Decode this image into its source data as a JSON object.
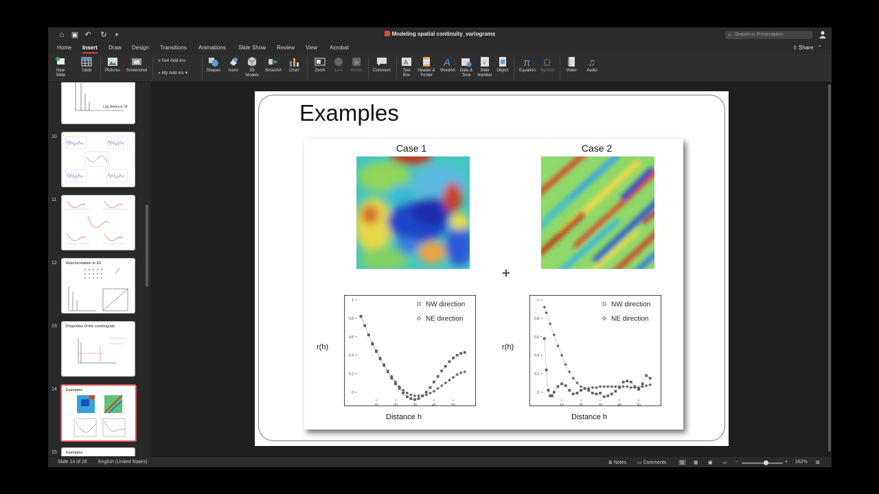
{
  "window": {
    "title": "Modeling spatial continuity_variograms",
    "search_placeholder": "Search in Presentation",
    "share_label": "Share"
  },
  "tabs": [
    "Home",
    "Insert",
    "Draw",
    "Design",
    "Transitions",
    "Animations",
    "Slide Show",
    "Review",
    "View",
    "Acrobat"
  ],
  "active_tab": "Insert",
  "ribbon": {
    "new_slide": "New Slide",
    "table": "Table",
    "pictures": "Pictures",
    "screenshot": "Screenshot",
    "get_addins": "Get Add-ins",
    "my_addins": "My Add-ins",
    "shapes": "Shapes",
    "icons": "Icons",
    "models_3d": "3D Models",
    "smartart": "SmartArt",
    "chart": "Chart",
    "zoom": "Zoom",
    "link": "Link",
    "action": "Action",
    "comment": "Comment",
    "text_box": "Text Box",
    "header_footer": "Header & Footer",
    "wordart": "WordArt",
    "date_time": "Date & Time",
    "slide_number": "Slide Number",
    "object": "Object",
    "equation": "Equation",
    "symbol": "Symbol",
    "video": "Video",
    "audio": "Audio"
  },
  "thumbnails": [
    {
      "number": "",
      "title": "",
      "caption": "Lag distance, M"
    },
    {
      "number": "10",
      "title": ""
    },
    {
      "number": "11",
      "title": ""
    },
    {
      "number": "12",
      "title": "Autocorrelation in 2D"
    },
    {
      "number": "13",
      "title": "Properties of the correlogram"
    },
    {
      "number": "14",
      "title": "Examples"
    },
    {
      "number": "15",
      "title": "Examples"
    }
  ],
  "slide": {
    "title": "Examples",
    "case1_title": "Case 1",
    "case2_title": "Case 2",
    "ylabel": "r(h)",
    "xlabel": "Distance h",
    "legend_nw": "NW direction",
    "legend_ne": "NE direction"
  },
  "chart_data": [
    {
      "type": "scatter",
      "title": "Case 1",
      "xlabel": "Distance h",
      "ylabel": "r(h)",
      "xlim": [
        0,
        60
      ],
      "ylim": [
        -0.1,
        1.0
      ],
      "x_ticks": [
        10,
        20,
        30,
        40,
        50
      ],
      "y_ticks": [
        0,
        0.2,
        0.4,
        0.6,
        0.8,
        1
      ],
      "legend_position": "top-right",
      "series": [
        {
          "name": "NW direction",
          "marker": "square",
          "x": [
            2,
            4,
            6,
            8,
            10,
            12,
            14,
            16,
            18,
            20,
            22,
            24,
            26,
            28,
            30,
            32,
            34,
            36,
            38,
            40,
            42,
            44,
            46,
            48,
            50,
            52,
            54,
            56
          ],
          "y": [
            0.82,
            0.72,
            0.62,
            0.52,
            0.44,
            0.36,
            0.29,
            0.22,
            0.15,
            0.09,
            0.04,
            -0.01,
            -0.05,
            -0.07,
            -0.08,
            -0.07,
            -0.04,
            0.0,
            0.05,
            0.11,
            0.17,
            0.23,
            0.28,
            0.33,
            0.37,
            0.4,
            0.42,
            0.43
          ]
        },
        {
          "name": "NE direction",
          "marker": "diamond",
          "x": [
            2,
            4,
            6,
            8,
            10,
            12,
            14,
            16,
            18,
            20,
            22,
            24,
            26,
            28,
            30,
            32,
            34,
            36,
            38,
            40,
            42,
            44,
            46,
            48,
            50,
            52,
            54,
            56
          ],
          "y": [
            0.82,
            0.72,
            0.62,
            0.53,
            0.45,
            0.37,
            0.3,
            0.23,
            0.17,
            0.11,
            0.06,
            0.02,
            -0.01,
            -0.03,
            -0.04,
            -0.04,
            -0.04,
            -0.03,
            -0.01,
            0.01,
            0.04,
            0.07,
            0.1,
            0.13,
            0.16,
            0.19,
            0.21,
            0.22
          ]
        }
      ]
    },
    {
      "type": "scatter",
      "title": "Case 2",
      "xlabel": "Distance h",
      "ylabel": "r(h)",
      "xlim": [
        0,
        60
      ],
      "ylim": [
        -0.1,
        1.0
      ],
      "x_ticks": [
        10,
        20,
        30,
        40,
        50
      ],
      "y_ticks": [
        0,
        0.2,
        0.4,
        0.6,
        0.8,
        1
      ],
      "legend_position": "top-right",
      "series": [
        {
          "name": "NW direction",
          "marker": "square",
          "x": [
            1,
            2,
            3,
            4,
            5,
            6,
            8,
            10,
            12,
            14,
            16,
            18,
            20,
            22,
            24,
            26,
            28,
            30,
            32,
            34,
            36,
            38,
            40,
            42,
            44,
            46,
            48,
            50,
            52,
            54,
            56
          ],
          "y": [
            0.58,
            0.24,
            0.02,
            -0.04,
            -0.04,
            0.0,
            0.06,
            0.09,
            0.07,
            0.02,
            -0.02,
            -0.01,
            0.02,
            0.04,
            0.02,
            -0.01,
            -0.02,
            -0.01,
            -0.05,
            -0.04,
            -0.02,
            0.01,
            0.05,
            0.11,
            0.12,
            0.11,
            0.06,
            0.03,
            0.09,
            0.18,
            0.15
          ]
        },
        {
          "name": "NE direction",
          "marker": "diamond",
          "x": [
            1,
            2,
            4,
            6,
            8,
            10,
            12,
            14,
            16,
            18,
            20,
            22,
            24,
            26,
            28,
            30,
            32,
            34,
            36,
            38,
            40,
            42,
            44,
            46,
            48,
            50,
            52,
            54,
            56
          ],
          "y": [
            0.92,
            0.86,
            0.74,
            0.62,
            0.5,
            0.4,
            0.3,
            0.22,
            0.15,
            0.1,
            0.06,
            0.04,
            0.04,
            0.05,
            0.05,
            0.06,
            0.06,
            0.06,
            0.06,
            0.06,
            0.06,
            0.06,
            0.06,
            0.05,
            0.05,
            0.05,
            0.06,
            0.07,
            0.08
          ]
        }
      ]
    }
  ],
  "status": {
    "slide_info": "Slide 14 of 26",
    "language": "English (United States)",
    "notes": "Notes",
    "comments": "Comments",
    "zoom": "162%"
  }
}
